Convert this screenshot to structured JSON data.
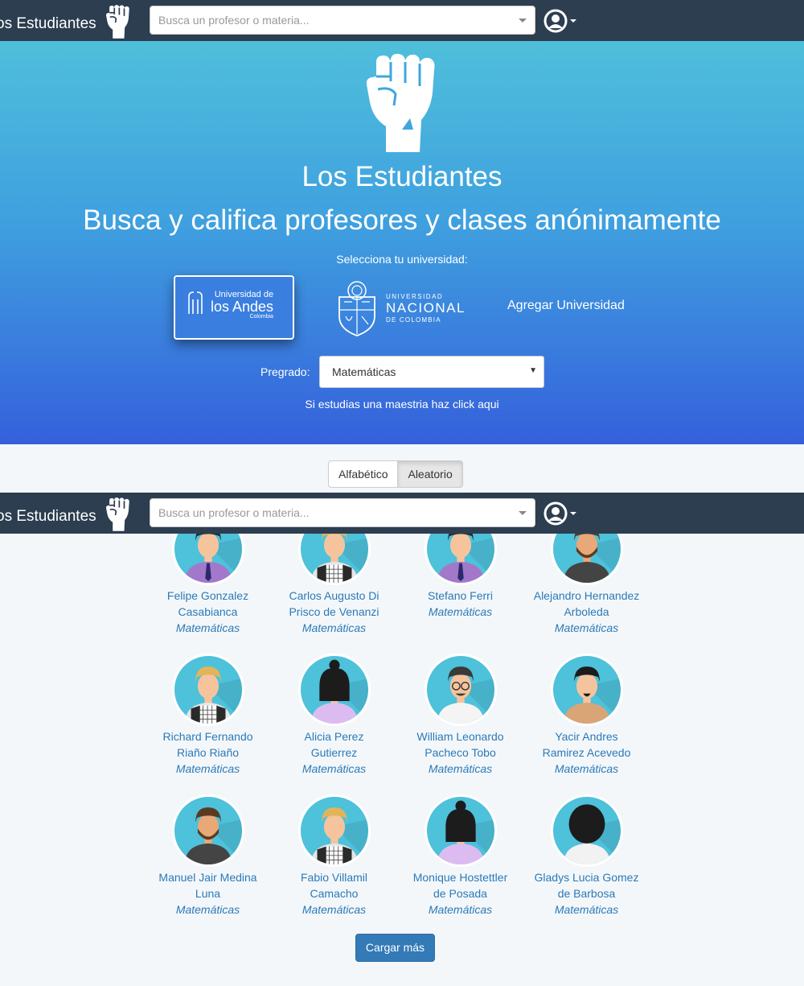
{
  "navbar": {
    "brand": "os Estudiantes",
    "search_placeholder": "Busca un profesor o materia..."
  },
  "hero": {
    "title": "Los Estudiantes",
    "subtitle": "Busca y califica profesores y clases anónimamente",
    "select_university_label": "Selecciona tu universidad:",
    "andes": {
      "line1": "Universidad de",
      "line2": "los Andes",
      "line3": "Colombia"
    },
    "nacional": {
      "line1": "UNIVERSIDAD",
      "line2": "NACIONAL",
      "line3": "DE COLOMBIA"
    },
    "add_university": "Agregar Universidad",
    "pregrado_label": "Pregrado:",
    "pregrado_selected": "Matemáticas",
    "maestria_link": "Si estudias una maestria haz click aqui"
  },
  "sort": {
    "alphabetic": "Alfabético",
    "random": "Aleatorio",
    "selected": "Aleatorio"
  },
  "professors": [
    {
      "name": "Felipe Gonzalez Casabianca",
      "subject": "Matemáticas",
      "avatar": "man-purple-shirt"
    },
    {
      "name": "Carlos Augusto Di Prisco de Venanzi",
      "subject": "Matemáticas",
      "avatar": "man-blonde-plaid"
    },
    {
      "name": "Stefano Ferri",
      "subject": "Matemáticas",
      "avatar": "man-purple-shirt"
    },
    {
      "name": "Alejandro Hernandez Arboleda",
      "subject": "Matemáticas",
      "avatar": "man-beard-dark"
    },
    {
      "name": "Richard Fernando Riaño Riaño",
      "subject": "Matemáticas",
      "avatar": "man-blonde-plaid"
    },
    {
      "name": "Alicia Perez Gutierrez",
      "subject": "Matemáticas",
      "avatar": "woman-ponytail-lilac"
    },
    {
      "name": "William Leonardo Pacheco Tobo",
      "subject": "Matemáticas",
      "avatar": "man-glasses-white"
    },
    {
      "name": "Yacir Andres Ramirez Acevedo",
      "subject": "Matemáticas",
      "avatar": "man-goatee-tan"
    },
    {
      "name": "Manuel Jair Medina Luna",
      "subject": "Matemáticas",
      "avatar": "man-beard-dark"
    },
    {
      "name": "Fabio Villamil Camacho",
      "subject": "Matemáticas",
      "avatar": "man-blonde-plaid"
    },
    {
      "name": "Monique Hostettler de Posada",
      "subject": "Matemáticas",
      "avatar": "woman-ponytail-lilac"
    },
    {
      "name": "Gladys Lucia Gomez de Barbosa",
      "subject": "Matemáticas",
      "avatar": "woman-curly-white"
    }
  ],
  "load_more": "Cargar más",
  "colors": {
    "navbar": "#2c3e50",
    "hero_top": "#4fbfdb",
    "hero_bottom": "#3560dc",
    "link": "#2a7ab8",
    "avatar_bg": "#4ec1db"
  }
}
